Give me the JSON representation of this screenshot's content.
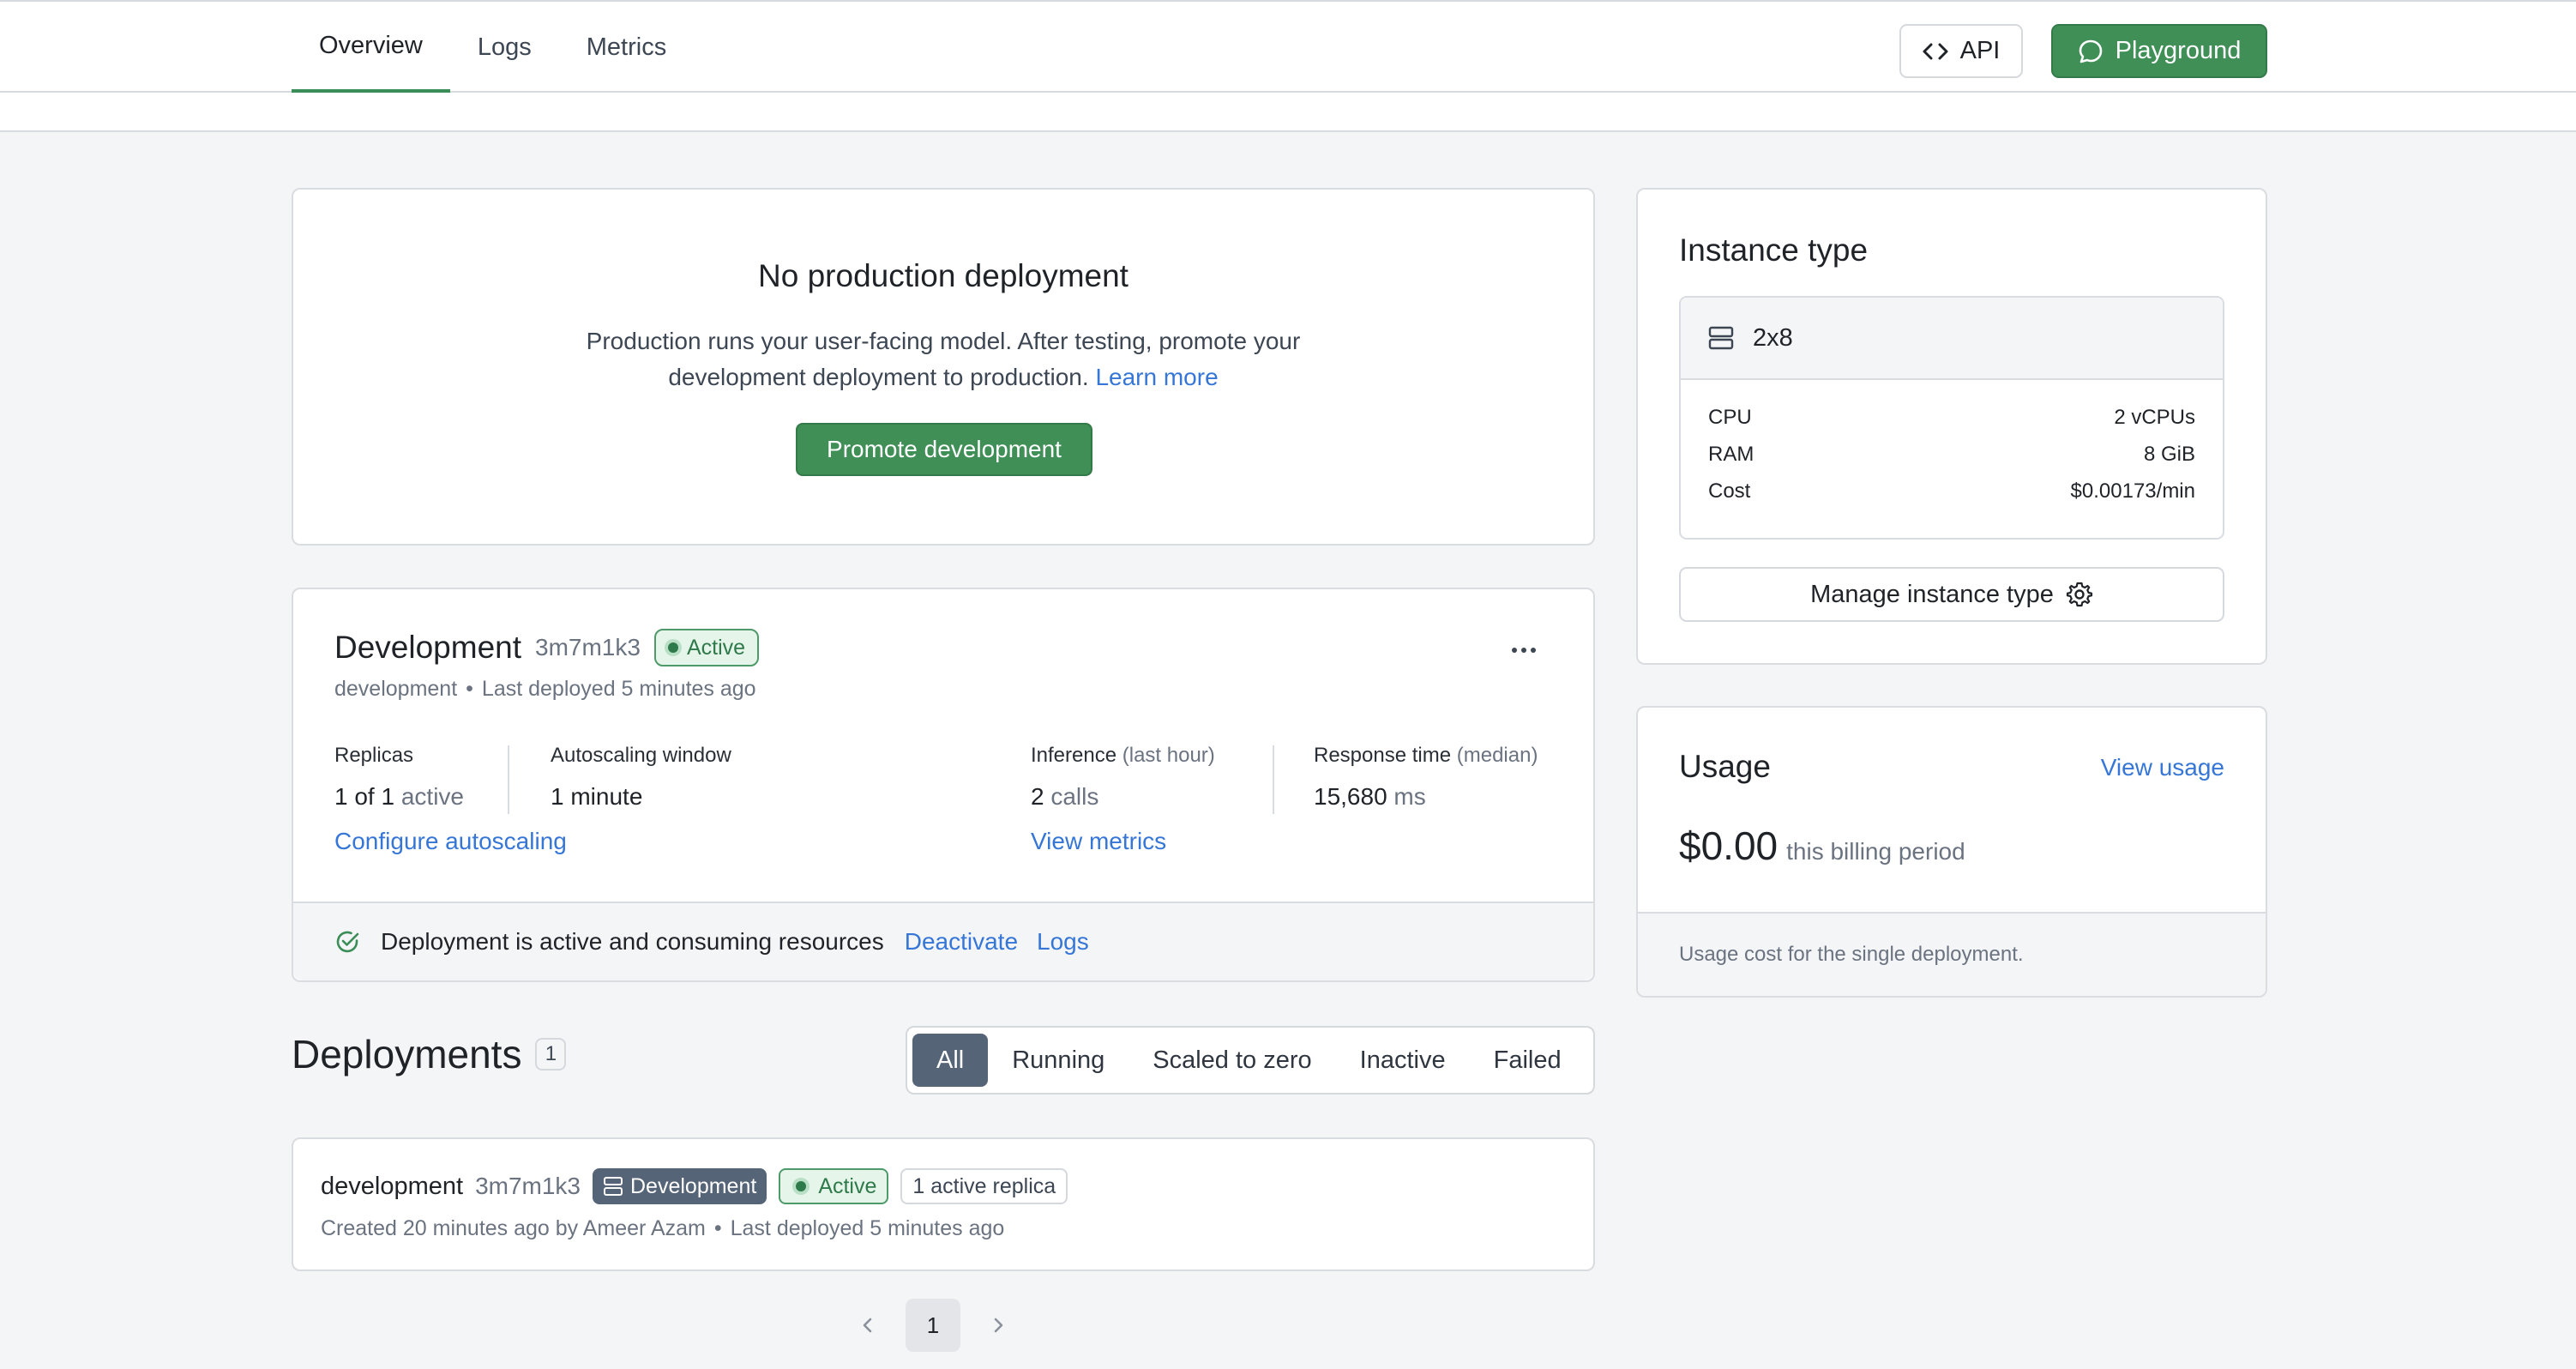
{
  "nav": {
    "tabs": [
      "Overview",
      "Logs",
      "Metrics"
    ],
    "api_label": "API",
    "playground_label": "Playground"
  },
  "production": {
    "title": "No production deployment",
    "desc_line1": "Production runs your user-facing model. After testing, promote your",
    "desc_line2": "development deployment to production.",
    "learn_more": "Learn more",
    "promote_button": "Promote development"
  },
  "development": {
    "title": "Development",
    "id": "3m7m1k3",
    "status": "Active",
    "meta_env": "development",
    "meta_sep": "•",
    "meta_deployed": "Last deployed 5 minutes ago",
    "more_icon": "more-icon",
    "stats": {
      "replicas_label": "Replicas",
      "replicas_value": "1 of 1",
      "replicas_suffix": "active",
      "autoscaling_label": "Autoscaling window",
      "autoscaling_value": "1 minute",
      "configure_link": "Configure autoscaling",
      "inference_label": "Inference",
      "inference_qualifier": "(last hour)",
      "inference_value": "2",
      "inference_suffix": "calls",
      "metrics_link": "View metrics",
      "response_label": "Response time",
      "response_qualifier": "(median)",
      "response_value": "15,680",
      "response_suffix": "ms"
    },
    "footer": {
      "message": "Deployment is active and consuming resources",
      "deactivate": "Deactivate",
      "logs": "Logs"
    }
  },
  "instance": {
    "title": "Instance type",
    "name": "2x8",
    "rows": [
      {
        "label": "CPU",
        "value": "2 vCPUs"
      },
      {
        "label": "RAM",
        "value": "8 GiB"
      },
      {
        "label": "Cost",
        "value": "$0.00173/min"
      }
    ],
    "manage_button": "Manage instance type"
  },
  "usage": {
    "title": "Usage",
    "view_link": "View usage",
    "amount": "$0.00",
    "period": "this billing period",
    "footer": "Usage cost for the single deployment."
  },
  "deployments": {
    "title": "Deployments",
    "count": "1",
    "filters": [
      "All",
      "Running",
      "Scaled to zero",
      "Inactive",
      "Failed"
    ],
    "row": {
      "name": "development",
      "id": "3m7m1k3",
      "env_badge": "Development",
      "status_badge": "Active",
      "replica_badge": "1 active replica",
      "created": "Created 20 minutes ago by Ameer Azam",
      "sep": "•",
      "deployed": "Last deployed 5 minutes ago"
    },
    "pagination": {
      "page": "1"
    }
  },
  "colors": {
    "accent_green": "#3f8f57",
    "link_blue": "#3576d6",
    "active_badge_bg": "#e6f5ea",
    "env_badge_bg": "#556477"
  }
}
